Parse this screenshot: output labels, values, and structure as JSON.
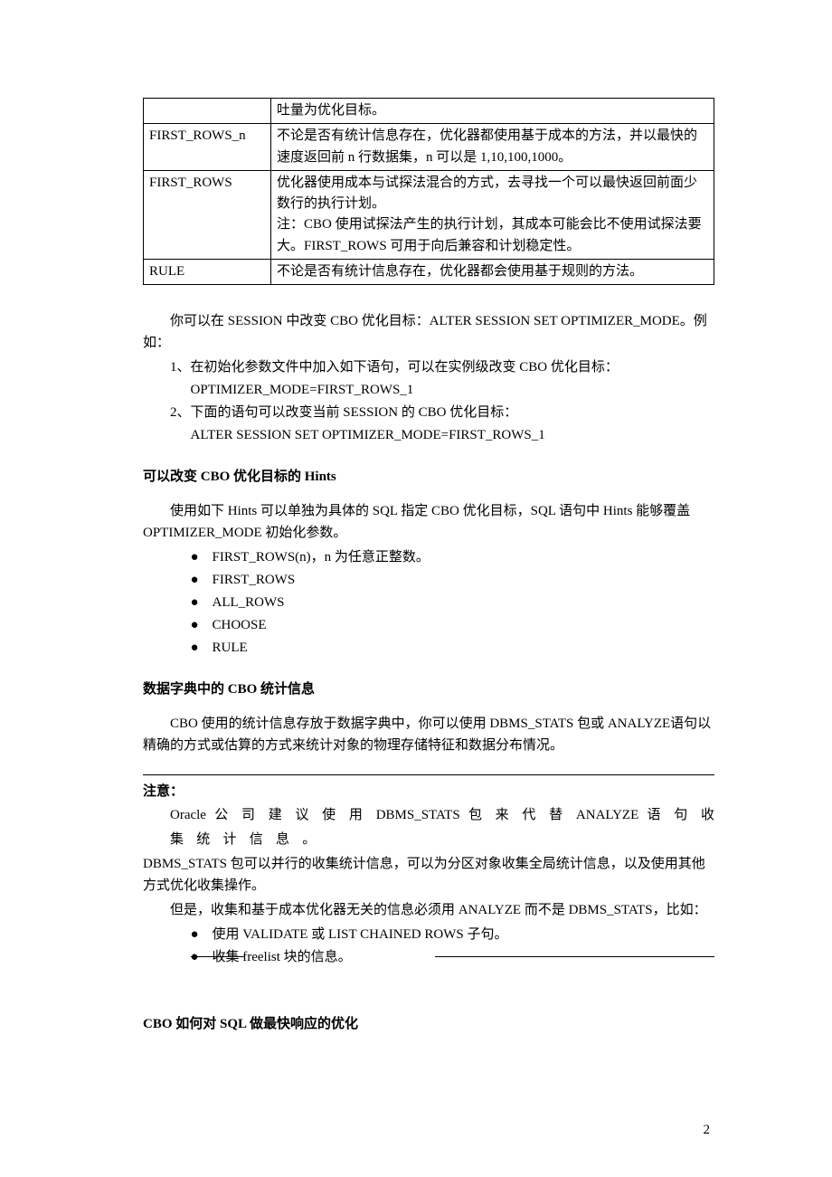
{
  "table": {
    "rows": [
      {
        "c1": "",
        "c2": "吐量为优化目标。"
      },
      {
        "c1": "FIRST_ROWS_n",
        "c2": "不论是否有统计信息存在，优化器都使用基于成本的方法，并以最快的速度返回前  n  行数据集，n  可以是  1,10,100,1000。"
      },
      {
        "c1": "FIRST_ROWS",
        "c2": "优化器使用成本与试探法混合的方式，去寻找一个可以最快返回前面少数行的执行计划。\n注：CBO  使用试探法产生的执行计划，其成本可能会比不使用试探法要大。FIRST_ROWS  可用于向后兼容和计划稳定性。"
      },
      {
        "c1": "RULE",
        "c2": "不论是否有统计信息存在，优化器都会使用基于规则的方法。"
      }
    ]
  },
  "section1": {
    "p1": "你可以在  SESSION  中改变  CBO  优化目标：ALTER SESSION SET OPTIMIZER_MODE。例如：",
    "l1": "1、在初始化参数文件中加入如下语句，可以在实例级改变  CBO  优化目标：",
    "l1s": "OPTIMIZER_MODE=FIRST_ROWS_1",
    "l2": "2、下面的语句可以改变当前  SESSION  的  CBO  优化目标：",
    "l2s": "ALTER SESSION SET OPTIMIZER_MODE=FIRST_ROWS_1"
  },
  "h1": "可以改变  CBO  优化目标的  Hints",
  "section2": {
    "p1": "使用如下  Hints  可以单独为具体的  SQL  指定  CBO  优化目标，SQL  语句中  Hints  能够覆盖  OPTIMIZER_MODE  初始化参数。",
    "bullets": [
      "FIRST_ROWS(n)，n  为任意正整数。",
      "FIRST_ROWS",
      "ALL_ROWS",
      "CHOOSE",
      "RULE"
    ]
  },
  "h2": "数据字典中的  CBO  统计信息",
  "section3": {
    "p1": "CBO 使用的统计信息存放于数据字典中，你可以使用  DBMS_STATS  包或  ANALYZE语句以精确的方式或估算的方式来统计对象的物理存储特征和数据分布情况。"
  },
  "note": {
    "label": "注意：",
    "line1a": "Oracle 公 司 建 议 使 用 ",
    "line1b": "DBMS_STATS",
    "line1c": " 包 来 代 替 ",
    "line1d": "ANALYZE",
    "line1e": " 语 句 收",
    "line2": "集 统 计 信 息 。",
    "p2": "DBMS_STATS  包可以并行的收集统计信息，可以为分区对象收集全局统计信息，以及使用其他方式优化收集操作。",
    "p3": "但是，收集和基于成本优化器无关的信息必须用  ANALYZE  而不是  DBMS_STATS，比如：",
    "b1": "使用  VALIDATE  或  LIST CHAINED ROWS 子句。",
    "b2": "收集  freelist  块的信息。"
  },
  "h3": "CBO  如何对  SQL  做最快响应的优化",
  "pagenum": "2"
}
